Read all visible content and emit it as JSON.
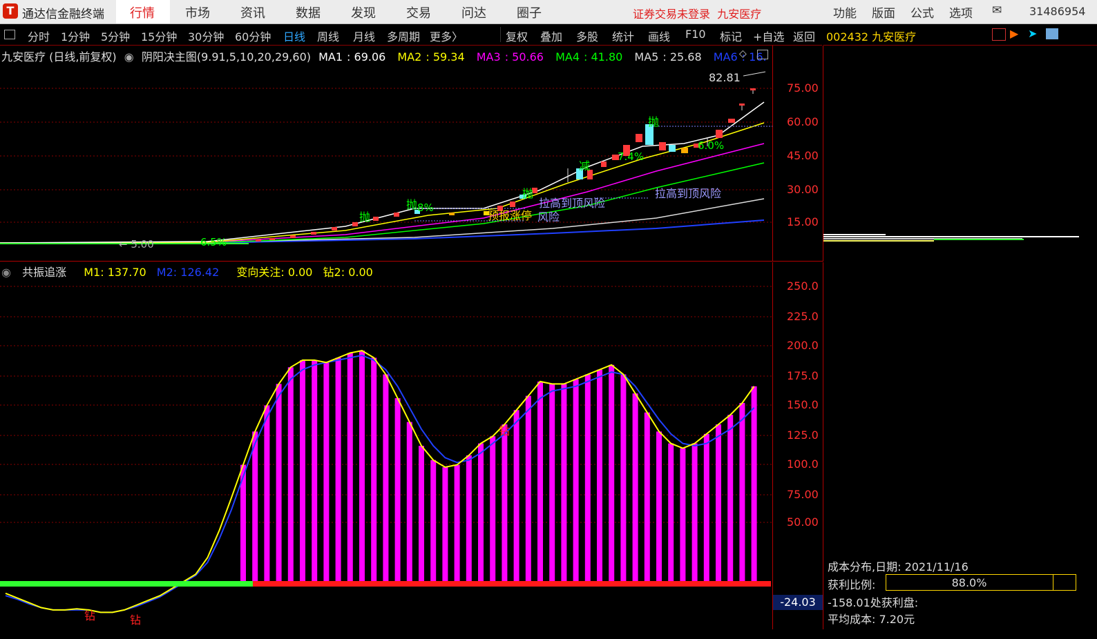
{
  "menu": {
    "logo_glyph": "✉",
    "app_title": "通达信金融终端",
    "tabs": [
      "行情",
      "市场",
      "资讯",
      "数据",
      "发现",
      "交易",
      "问达",
      "圈子"
    ],
    "active_tab": "行情",
    "notice": "证券交易未登录",
    "stock_name": "九安医疗",
    "right_tabs": [
      "功能",
      "版面",
      "公式",
      "选项"
    ],
    "mail_glyph": "✉",
    "account": "31486954"
  },
  "toolbar": {
    "periods": [
      "分时",
      "1分钟",
      "5分钟",
      "15分钟",
      "30分钟",
      "60分钟",
      "日线",
      "周线",
      "月线",
      "多周期",
      "更多〉"
    ],
    "active_period": "日线",
    "tools": [
      "复权",
      "叠加",
      "多股",
      "统计",
      "画线",
      "F10",
      "标记",
      "+自选",
      "返回"
    ],
    "code_label": "002432 九安医疗"
  },
  "main_chart": {
    "title": "九安医疗 (日线,前复权)",
    "indicator_label": "阴阳决主图(9.91,5,10,20,29,60)",
    "ma": [
      {
        "name": "MA1",
        "value": "69.06",
        "color": "#ffffff"
      },
      {
        "name": "MA2",
        "value": "59.34",
        "color": "#ffff00"
      },
      {
        "name": "MA3",
        "value": "50.66",
        "color": "#ff00ff"
      },
      {
        "name": "MA4",
        "value": "41.80",
        "color": "#00ff00"
      },
      {
        "name": "MA5",
        "value": "25.68",
        "color": "#dddddd"
      },
      {
        "name": "MA6",
        "value": "16.",
        "color": "#2040ff"
      }
    ],
    "axis_ticks": [
      "75.00",
      "60.00",
      "45.00",
      "30.00",
      "15.00"
    ],
    "high_label": "82.81",
    "low_label": "← 5.00",
    "annotations": [
      {
        "text": "抛",
        "color": "#00ff00"
      },
      {
        "text": "抛",
        "color": "#00ff00"
      },
      {
        "text": "抛",
        "color": "#00ff00"
      },
      {
        "text": "减",
        "color": "#00ff00"
      },
      {
        "text": "抛",
        "color": "#00ff00"
      },
      {
        "text": "6.5%",
        "color": "#00ff00"
      },
      {
        "text": "8%",
        "color": "#00ff00"
      },
      {
        "text": "7.4%",
        "color": "#00ff00"
      },
      {
        "text": "6.0%",
        "color": "#00ff00"
      },
      {
        "text": "拉高到顶风险",
        "color": "#9a9aff"
      },
      {
        "text": "拉高到顶风险",
        "color": "#9a9aff"
      },
      {
        "text": "预报涨停",
        "color": "#ffd700"
      },
      {
        "text": "风险",
        "color": "#9a9aff"
      }
    ]
  },
  "sub_chart": {
    "title": "共振追涨",
    "m1_label": "M1: 137.70",
    "m2_label": "M2: 126.42",
    "bx_label": "变向关注: 0.00",
    "z2_label": "钻2: 0.00",
    "axis_ticks": [
      "250.0",
      "225.0",
      "200.0",
      "175.0",
      "150.0",
      "125.0",
      "100.0",
      "75.00",
      "50.00"
    ],
    "neg_label": "-24.03",
    "markers": [
      "钻",
      "钻",
      "钻"
    ]
  },
  "chart_data": {
    "type": "bar",
    "title": "共振追涨",
    "ylim": [
      -24.03,
      260
    ],
    "series": [
      {
        "name": "M1",
        "values": [
          -8,
          -12,
          -16,
          -20,
          -22,
          -22,
          -21,
          -22,
          -24,
          -24,
          -22,
          -18,
          -14,
          -10,
          -4,
          2,
          8,
          22,
          45,
          72,
          100,
          128,
          150,
          168,
          182,
          188,
          188,
          186,
          190,
          194,
          196,
          190,
          176,
          156,
          136,
          116,
          104,
          98,
          100,
          108,
          118,
          124,
          134,
          146,
          158,
          170,
          168,
          168,
          172,
          176,
          180,
          184,
          176,
          160,
          144,
          128,
          118,
          114,
          118,
          126,
          134,
          142,
          152,
          166
        ]
      },
      {
        "name": "M2",
        "values": [
          -10,
          -13,
          -17,
          -20,
          -22,
          -22,
          -22,
          -22,
          -24,
          -24,
          -22,
          -19,
          -15,
          -11,
          -5,
          1,
          7,
          18,
          38,
          62,
          90,
          118,
          140,
          158,
          172,
          180,
          184,
          186,
          188,
          190,
          192,
          188,
          180,
          166,
          148,
          130,
          116,
          106,
          102,
          104,
          110,
          118,
          126,
          136,
          146,
          156,
          162,
          164,
          166,
          170,
          174,
          178,
          176,
          166,
          152,
          138,
          126,
          118,
          116,
          118,
          124,
          130,
          138,
          148
        ]
      }
    ]
  },
  "right_panel": {
    "cost_title": "成本分布,日期: 2021/11/16",
    "profit_label": "获利比例:",
    "profit_ratio": 0.88,
    "profit_text": "88.0%",
    "profit_disk": "-158.01处获利盘:",
    "avg_cost": "平均成本: 7.20元"
  }
}
